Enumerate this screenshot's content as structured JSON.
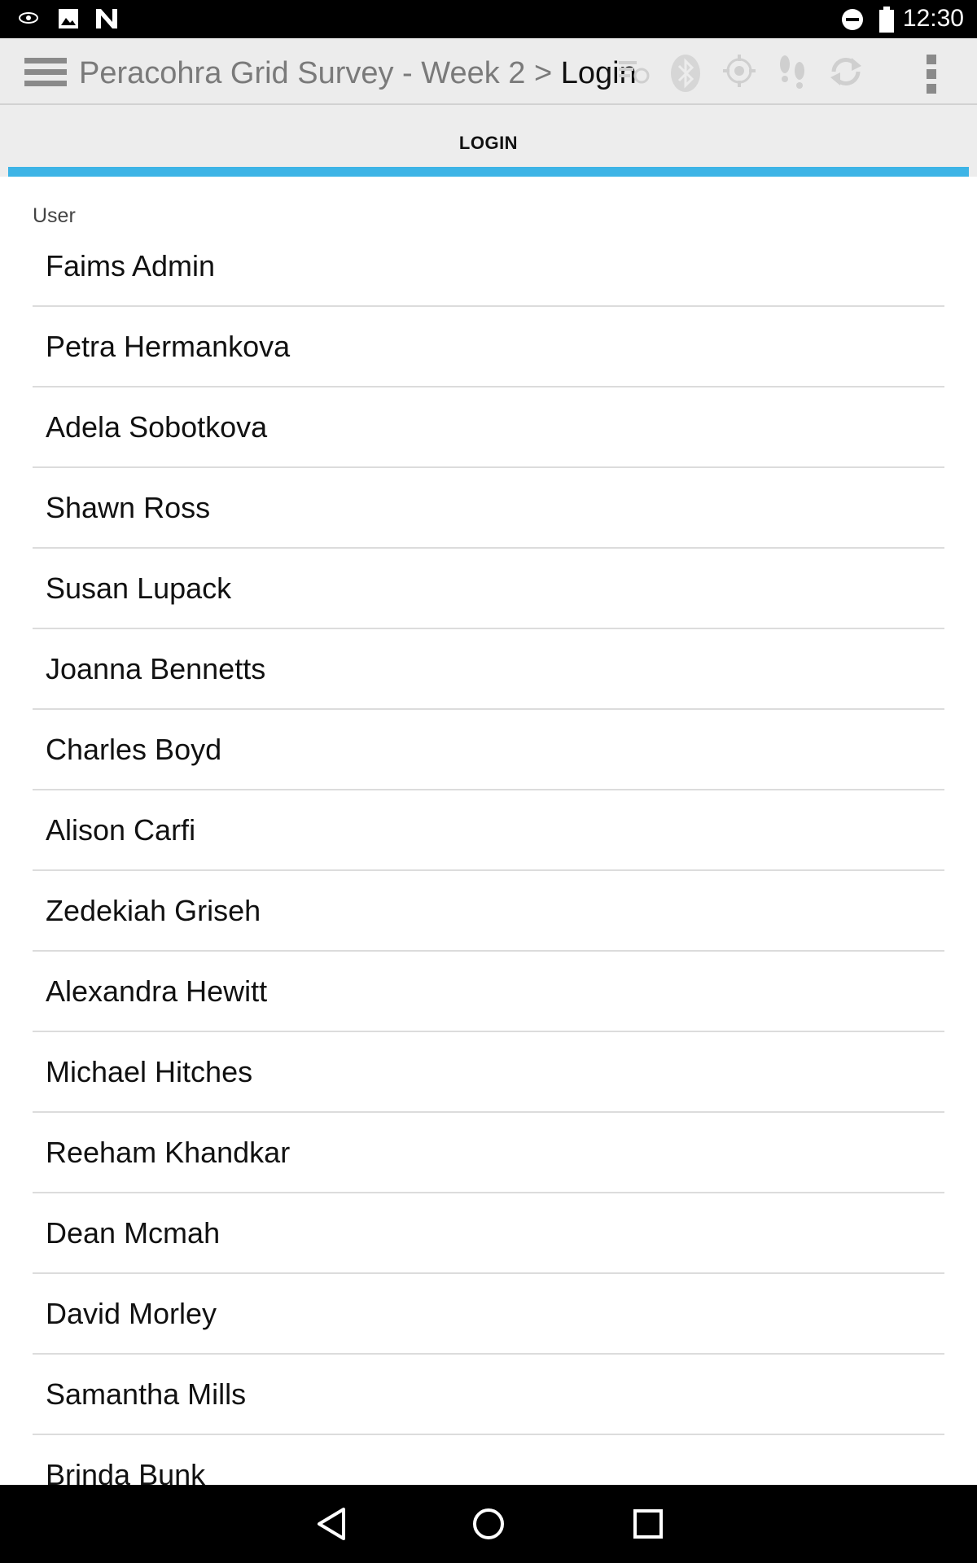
{
  "status_bar": {
    "time": "12:30",
    "left_icons": [
      "eye-icon",
      "image-icon",
      "nvidia-icon"
    ],
    "right_icons": [
      "do-not-disturb-icon",
      "battery-icon"
    ]
  },
  "action_bar": {
    "breadcrumb_parent": "Peracohra Grid Survey - Week 2",
    "breadcrumb_separator": ">",
    "breadcrumb_current": "Login",
    "icons": [
      "menu-icon",
      "sync-list-icon",
      "bluetooth-icon",
      "gps-icon",
      "footsteps-icon",
      "refresh-icon",
      "overflow-menu-icon"
    ]
  },
  "tabs": [
    {
      "label": "LOGIN",
      "active": true
    }
  ],
  "form": {
    "section_label": "User",
    "users": [
      "Faims Admin",
      "Petra Hermankova",
      "Adela Sobotkova",
      "Shawn Ross",
      "Susan Lupack",
      "Joanna Bennetts",
      "Charles Boyd",
      "Alison Carfi",
      "Zedekiah Griseh",
      "Alexandra Hewitt",
      "Michael Hitches",
      "Reeham Khandkar",
      "Dean Mcmah",
      "David Morley",
      "Samantha Mills",
      "Brinda Bunk"
    ]
  },
  "nav_bar": {
    "icons": [
      "back-icon",
      "home-icon",
      "recents-icon"
    ]
  },
  "colors": {
    "accent": "#3db4e6",
    "action_bar_bg": "#ececec",
    "tab_bg": "#ededed"
  }
}
